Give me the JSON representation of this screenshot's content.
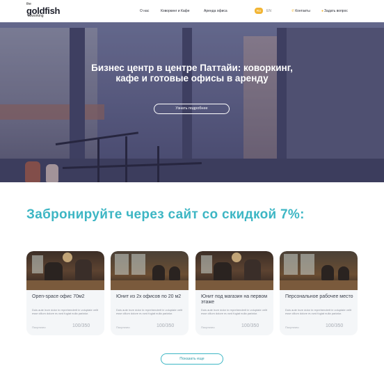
{
  "brand": {
    "the": "the",
    "name": "goldfish",
    "sub": "coworking"
  },
  "nav": {
    "items": [
      "О нас",
      "Коворкинг и Кафе",
      "Аренда офиса"
    ],
    "lang_active": "RU",
    "lang_other": "EN",
    "contacts": "Контакты",
    "ask": "Задать вопрос"
  },
  "hero": {
    "title": "Бизнес центр в центре Паттайи: коворкинг, кафе и готовые офисы в аренду",
    "button": "Узнать подробнее"
  },
  "promo": {
    "title": "Забронируйте через сайт со скидкой 7%:"
  },
  "cards": [
    {
      "title": "Open-space офис 70м2",
      "desc": "Duis aute irure dolor in reprehenderit in voluptate velit esse cillum dolore eu sed fugiat nulla pariatur.",
      "label": "Посуточно",
      "price": "100/350"
    },
    {
      "title": "Юнит из 2х офисов по 20 м2",
      "desc": "Duis aute irure dolor in reprehenderit in voluptate velit esse cillum dolore eu sed fugiat nulla pariatur.",
      "label": "Посуточно",
      "price": "100/350"
    },
    {
      "title": "Юнит под магазин на первом этаже",
      "desc": "Duis aute irure dolor in reprehenderit in voluptate velit esse cillum dolore eu sed fugiat nulla pariatur.",
      "label": "Посуточно",
      "price": "100/350"
    },
    {
      "title": "Персональное рабочее место",
      "desc": "Duis aute irure dolor in reprehenderit in voluptate velit esse cillum dolore eu sed fugiat nulla pariatur.",
      "label": "Посуточно",
      "price": "100/350"
    }
  ],
  "show_more": "Показать еще",
  "colors": {
    "accent": "#3db6c4",
    "lang_badge": "#f2b533",
    "hero_overlay": "#3c3464"
  }
}
